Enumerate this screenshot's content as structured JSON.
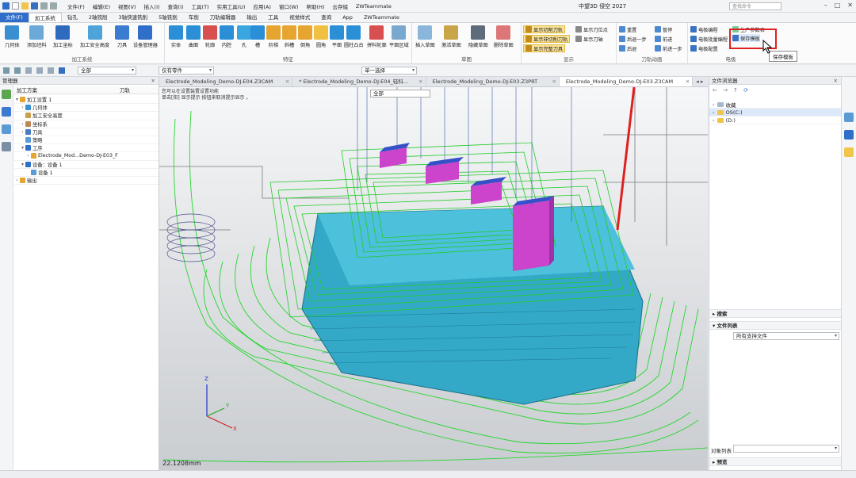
{
  "title": "中望3D 侵空 2027",
  "search_placeholder": "查找命令",
  "menu": [
    "文件(F)",
    "编辑(E)",
    "视图(V)",
    "插入(I)",
    "查询(I)",
    "工具(T)",
    "实用工具(U)",
    "应用(A)",
    "窗口(W)",
    "帮助(H)",
    "云存储",
    "ZWTeammate"
  ],
  "ribbon_tabs": [
    "文件(F)",
    "加工系统",
    "钻孔",
    "2轴铣削",
    "3轴快速铣削",
    "5轴铣削",
    "车削",
    "刀轨编辑器",
    "输出",
    "工具",
    "视觉样式",
    "查询",
    "App",
    "ZWTeammate"
  ],
  "ribbon": {
    "group_machining": {
      "label": "加工系统",
      "buttons": [
        "几何体",
        "添加坯料",
        "加工坐标",
        "加工安全高度",
        "刀具",
        "设备管理器"
      ]
    },
    "group_feature": {
      "label": "特征",
      "buttons": [
        "实体",
        "曲面",
        "轮廓",
        "内腔",
        "孔",
        "槽",
        "阶梯",
        "斜槽",
        "倒角",
        "圆角",
        "平面",
        "圆柱凸台",
        "拼料轮廓",
        "平面区域"
      ]
    },
    "group_sketch": {
      "label": "草图",
      "buttons": [
        "插入草图",
        "激活草图",
        "隐藏草图",
        "删除草图"
      ]
    },
    "group_display": {
      "label": "显示",
      "buttons": [
        "显示切削刀轨",
        "显示非切削刀轨",
        "显示完整刀具",
        "显示刀位点",
        "显示刀轴"
      ]
    },
    "group_anim": {
      "label": "刀轨动画",
      "buttons": [
        "重置",
        "后退一步",
        "后退",
        "暂停",
        "前进",
        "前进一步"
      ]
    },
    "group_electrode": {
      "label": "电极",
      "buttons": [
        "电极编程",
        "电极批量编程",
        "电极配置",
        "生产参数表",
        "保存模板"
      ]
    },
    "tooltip": "保存模板"
  },
  "toolbar": {
    "filter_all": "全部",
    "part_combo": "仅有零件",
    "select_mode": "单一选择"
  },
  "left_panel": {
    "title": "管理器",
    "col_plan": "加工方案",
    "col_toolpath": "刀轨",
    "tree": [
      "加工设置 1",
      "几何体",
      "加工安全高度",
      "坐标系",
      "刀具",
      "策略",
      "工序",
      "Electrode_Mod...Demo-DJ-E03_F",
      "设备：设备 1",
      "设备 1",
      "输出"
    ]
  },
  "doc_tabs": [
    "Electrode_Modeling_Demo-DJ-E04.Z3CAM",
    "* Electrode_Modeling_Demo-DJ-E04_轻科...",
    "Electrode_Modeling_Demo-DJ-E03.Z3PRT",
    "Electrode_Modeling_Demo-DJ-E03.Z3CAM"
  ],
  "viewport": {
    "hint1": "您可以在设置装置设置功能",
    "hint2": "单击[阳] 显示提示 按钮来取消提示显示 。",
    "filter": "全部",
    "scale": "22.1208mm",
    "axis_x": "X",
    "axis_y": "Y",
    "axis_z": "Z"
  },
  "right_panel": {
    "title": "文件浏览器",
    "items": [
      "收藏",
      "OS(C:)",
      "(D:)"
    ],
    "search_label": "搜索",
    "filelist_label": "文件列表",
    "filter": "所有支持文件",
    "object_list": "对象列表",
    "preview_label": "预览"
  },
  "colors": {
    "accent": "#2f6fc9",
    "toolpath": "#27d62f",
    "part": "#33a9c7",
    "highlight_box": "#e02020"
  }
}
